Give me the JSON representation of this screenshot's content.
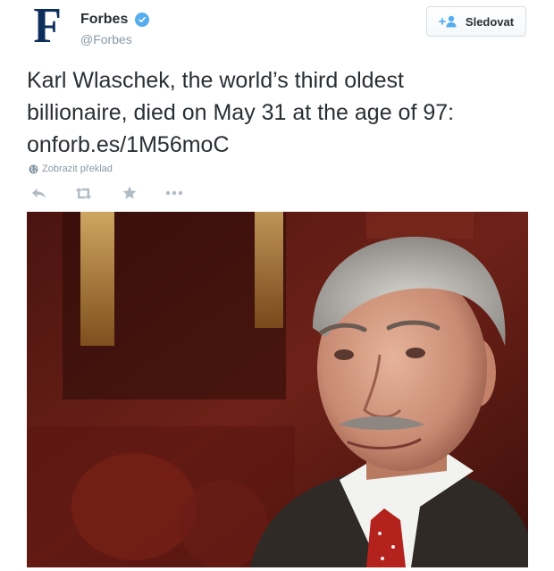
{
  "user": {
    "display_name": "Forbes",
    "screen_name": "@Forbes",
    "avatar_letter": "F",
    "verified": true
  },
  "follow_button": {
    "label": "Sledovat",
    "icon": "add-user-icon"
  },
  "tweet": {
    "text_lines": [
      "Karl Wlaschek, the world’s third oldest",
      "billionaire, died on May 31 at the age of 97:"
    ],
    "link": "onforb.es/1M56moC"
  },
  "translate": {
    "label": "Zobrazit překlad",
    "icon": "globe-icon"
  },
  "actions": [
    {
      "name": "reply",
      "icon": "reply-icon"
    },
    {
      "name": "retweet",
      "icon": "retweet-icon"
    },
    {
      "name": "favorite",
      "icon": "star-icon"
    },
    {
      "name": "more",
      "icon": "more-icon"
    }
  ],
  "media": {
    "kind": "photo",
    "subject": "portrait of an elderly man in a suit and red tie"
  },
  "colors": {
    "brand": "#0c2e5a",
    "verified": "#55acee",
    "muted": "#8899a6",
    "text": "#292f33",
    "icon": "#b1bbc3"
  }
}
